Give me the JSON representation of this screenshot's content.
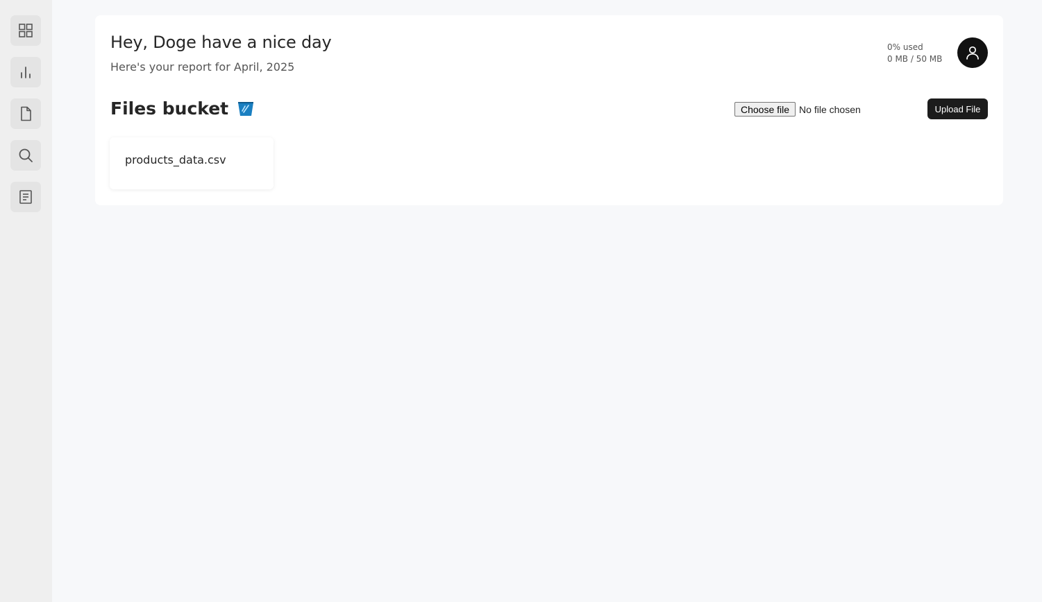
{
  "sidebar": {
    "items": [
      {
        "icon": "grid-icon"
      },
      {
        "icon": "bar-chart-icon"
      },
      {
        "icon": "document-icon"
      },
      {
        "icon": "search-icon"
      },
      {
        "icon": "notes-icon"
      }
    ]
  },
  "header": {
    "greeting": "Hey, Doge have a nice day",
    "subtitle": "Here's your report for April, 2025",
    "usage_percent": "0% used",
    "usage_amount": "0 MB / 50 MB",
    "avatar_icon": "user-icon"
  },
  "files": {
    "title": "Files bucket",
    "title_icon": "bucket-icon",
    "choose_label": "Choose file",
    "no_file_label": "No file chosen",
    "upload_label": "Upload File",
    "items": [
      {
        "name": "products_data.csv"
      }
    ]
  },
  "colors": {
    "sidebar_bg": "#efefef",
    "page_bg": "#f7f8fa",
    "button_dark": "#1c1c1c",
    "bucket_accent": "#1a7fc1"
  }
}
